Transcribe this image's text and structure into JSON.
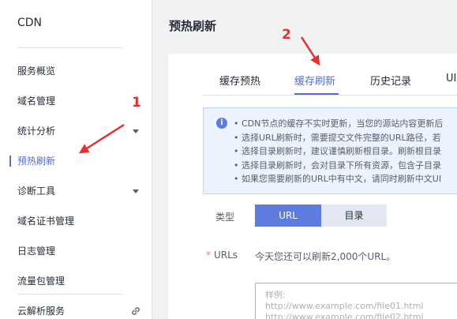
{
  "sidebar": {
    "title": "CDN",
    "items": [
      {
        "label": "服务概览"
      },
      {
        "label": "域名管理"
      },
      {
        "label": "统计分析"
      },
      {
        "label": "预热刷新"
      },
      {
        "label": "诊断工具"
      },
      {
        "label": "域名证书管理"
      },
      {
        "label": "日志管理"
      },
      {
        "label": "流量包管理"
      },
      {
        "label": "云解析服务"
      }
    ]
  },
  "page": {
    "title": "预热刷新"
  },
  "tabs": [
    {
      "label": "缓存预热"
    },
    {
      "label": "缓存刷新"
    },
    {
      "label": "历史记录"
    },
    {
      "label": "UI"
    }
  ],
  "notice": {
    "icon": "info-icon",
    "lines": [
      "• CDN节点的缓存不实时更新，当您的源站内容更新后",
      "• 选择URL刷新时，需要提交文件完整的URL路径，若",
      "• 选择目录刷新时，建议谨慎刷新根目录。刷新根目录",
      "• 选择目录刷新时，会对目录下所有资源，包含子目录",
      "• 如果您需要刷新的URL中有中文，请同时刷新中文UI"
    ]
  },
  "form": {
    "type_label": "类型",
    "type_options": [
      "URL",
      "目录"
    ],
    "type_selected": "URL",
    "urls_label": "URLs",
    "required_mark": "*",
    "urls_hint": "今天您还可以刷新2,000个URL。",
    "urls_placeholder": [
      "样例:",
      "http://www.example.com/file01.html",
      "http://www.example.com/file02.html"
    ]
  },
  "annotations": [
    {
      "label": "1",
      "color": "#e4312f"
    },
    {
      "label": "2",
      "color": "#e4312f"
    }
  ],
  "colors": {
    "accent": "#526ecc",
    "primary_button": "#5e7ce0",
    "annotation": "#e4312f"
  }
}
